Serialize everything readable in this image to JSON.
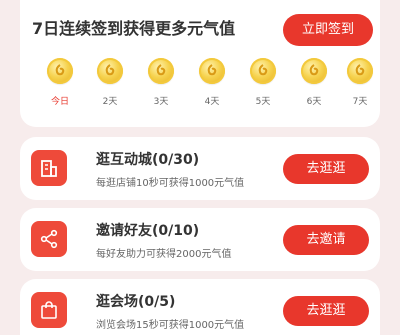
{
  "signin": {
    "title": "7日连续签到获得更多元气值",
    "button_label": "立即签到",
    "days": [
      {
        "label": "今日",
        "today": true
      },
      {
        "label": "2天",
        "today": false
      },
      {
        "label": "3天",
        "today": false
      },
      {
        "label": "4天",
        "today": false
      },
      {
        "label": "5天",
        "today": false
      },
      {
        "label": "6天",
        "today": false
      },
      {
        "label": "7天",
        "today": false
      }
    ]
  },
  "tasks": [
    {
      "title": "逛互动城(0/30)",
      "desc": "每逛店铺10秒可获得1000元气值",
      "button_label": "去逛逛",
      "icon": "store-icon"
    },
    {
      "title": "邀请好友(0/10)",
      "desc": "每好友助力可获得2000元气值",
      "button_label": "去邀请",
      "icon": "share-icon"
    },
    {
      "title": "逛会场(0/5)",
      "desc": "浏览会场15秒可获得1000元气值",
      "button_label": "去逛逛",
      "icon": "shopping-bag-icon"
    }
  ],
  "colors": {
    "accent": "#e8372c",
    "background": "#f7ecec",
    "coin": "#f6d24e"
  }
}
